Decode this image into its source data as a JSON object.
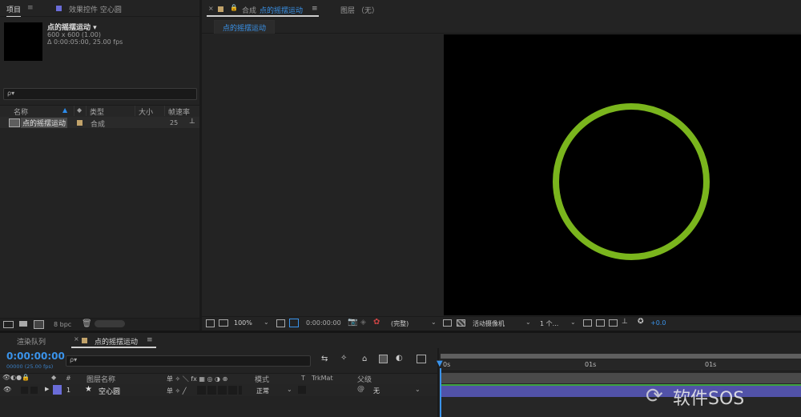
{
  "project_panel": {
    "tab_project": "项目",
    "tab_effects": "效果控件 空心圆",
    "comp_name": "点的摇摆运动 ▾",
    "comp_size": "600 x 600 (1.00)",
    "comp_duration": "Δ 0:00:05:00, 25.00 fps",
    "search_placeholder": "ρ▾",
    "col_name": "名称",
    "col_type": "类型",
    "col_size": "大小",
    "col_fps": "帧速率",
    "item_name": "点的摇摆运动",
    "item_type": "合成",
    "item_fps": "25",
    "bpc": "8 bpc"
  },
  "comp_panel": {
    "tab_label": "合成",
    "tab_comp": "点的摇摆运动",
    "layer_tab": "图层 （无）",
    "subtab": "点的摇摆运动",
    "zoom": "100%",
    "timecode": "0:00:00:00",
    "quality": "(完整)",
    "camera": "活动摄像机",
    "views": "1 个...",
    "exposure": "+0.0"
  },
  "canvas": {
    "circle_color": "#7ab51d"
  },
  "timeline": {
    "render_tab": "渲染队列",
    "comp_tab": "点的摇摆运动",
    "timecode": "0:00:00:00",
    "frames": "00000 (25.00 fps)",
    "search_placeholder": "ρ▾",
    "col_num": "#",
    "col_layer_name": "图层名称",
    "col_switches": "单 ✧ ＼ fx ▦ ◎ ◑ ⊕",
    "col_mode": "模式",
    "col_t": "T",
    "col_trkmat": "TrkMat",
    "col_parent": "父级",
    "layer_num": "1",
    "layer_name": "空心圆",
    "layer_mode": "正常",
    "layer_parent": "无",
    "ruler_0": "0s",
    "ruler_1": "01s",
    "ruler_2": "01s"
  },
  "watermark": {
    "text": "软件SOS"
  }
}
